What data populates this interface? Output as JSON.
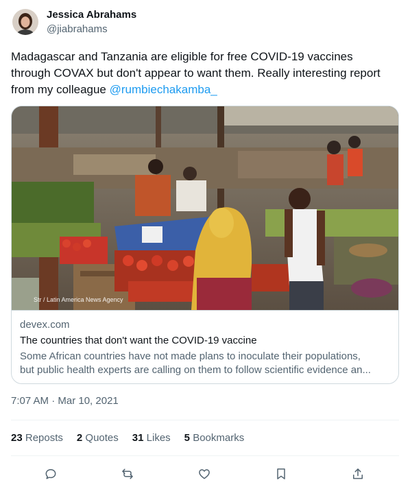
{
  "author": {
    "display_name": "Jessica Abrahams",
    "handle": "@jiabrahams"
  },
  "tweet": {
    "text_line1": "Madagascar and Tanzania are eligible for free COVID-19 vaccines",
    "text_line2": "through COVAX but don't appear to want them. Really interesting report",
    "text_line3_prefix": "from my colleague ",
    "mention": "@rumbiechakamba_"
  },
  "card": {
    "photo_credit": "Str / Latin America News Agency",
    "domain": "devex.com",
    "title": "The countries that don't want the COVID-19 vaccine",
    "description_line1": "Some African countries have not made plans to inoculate their populations,",
    "description_line2": "but public health experts are calling on them to follow scientific evidence an..."
  },
  "timestamp": "7:07 AM · Mar 10, 2021",
  "stats": {
    "reposts_count": "23",
    "reposts_label": "Reposts",
    "quotes_count": "2",
    "quotes_label": "Quotes",
    "likes_count": "31",
    "likes_label": "Likes",
    "bookmarks_count": "5",
    "bookmarks_label": "Bookmarks"
  },
  "colors": {
    "link": "#1d9bf0",
    "secondary_text": "#536471",
    "icon": "#536471"
  },
  "icons": [
    "reply-icon",
    "repost-icon",
    "like-icon",
    "bookmark-icon",
    "share-icon"
  ]
}
